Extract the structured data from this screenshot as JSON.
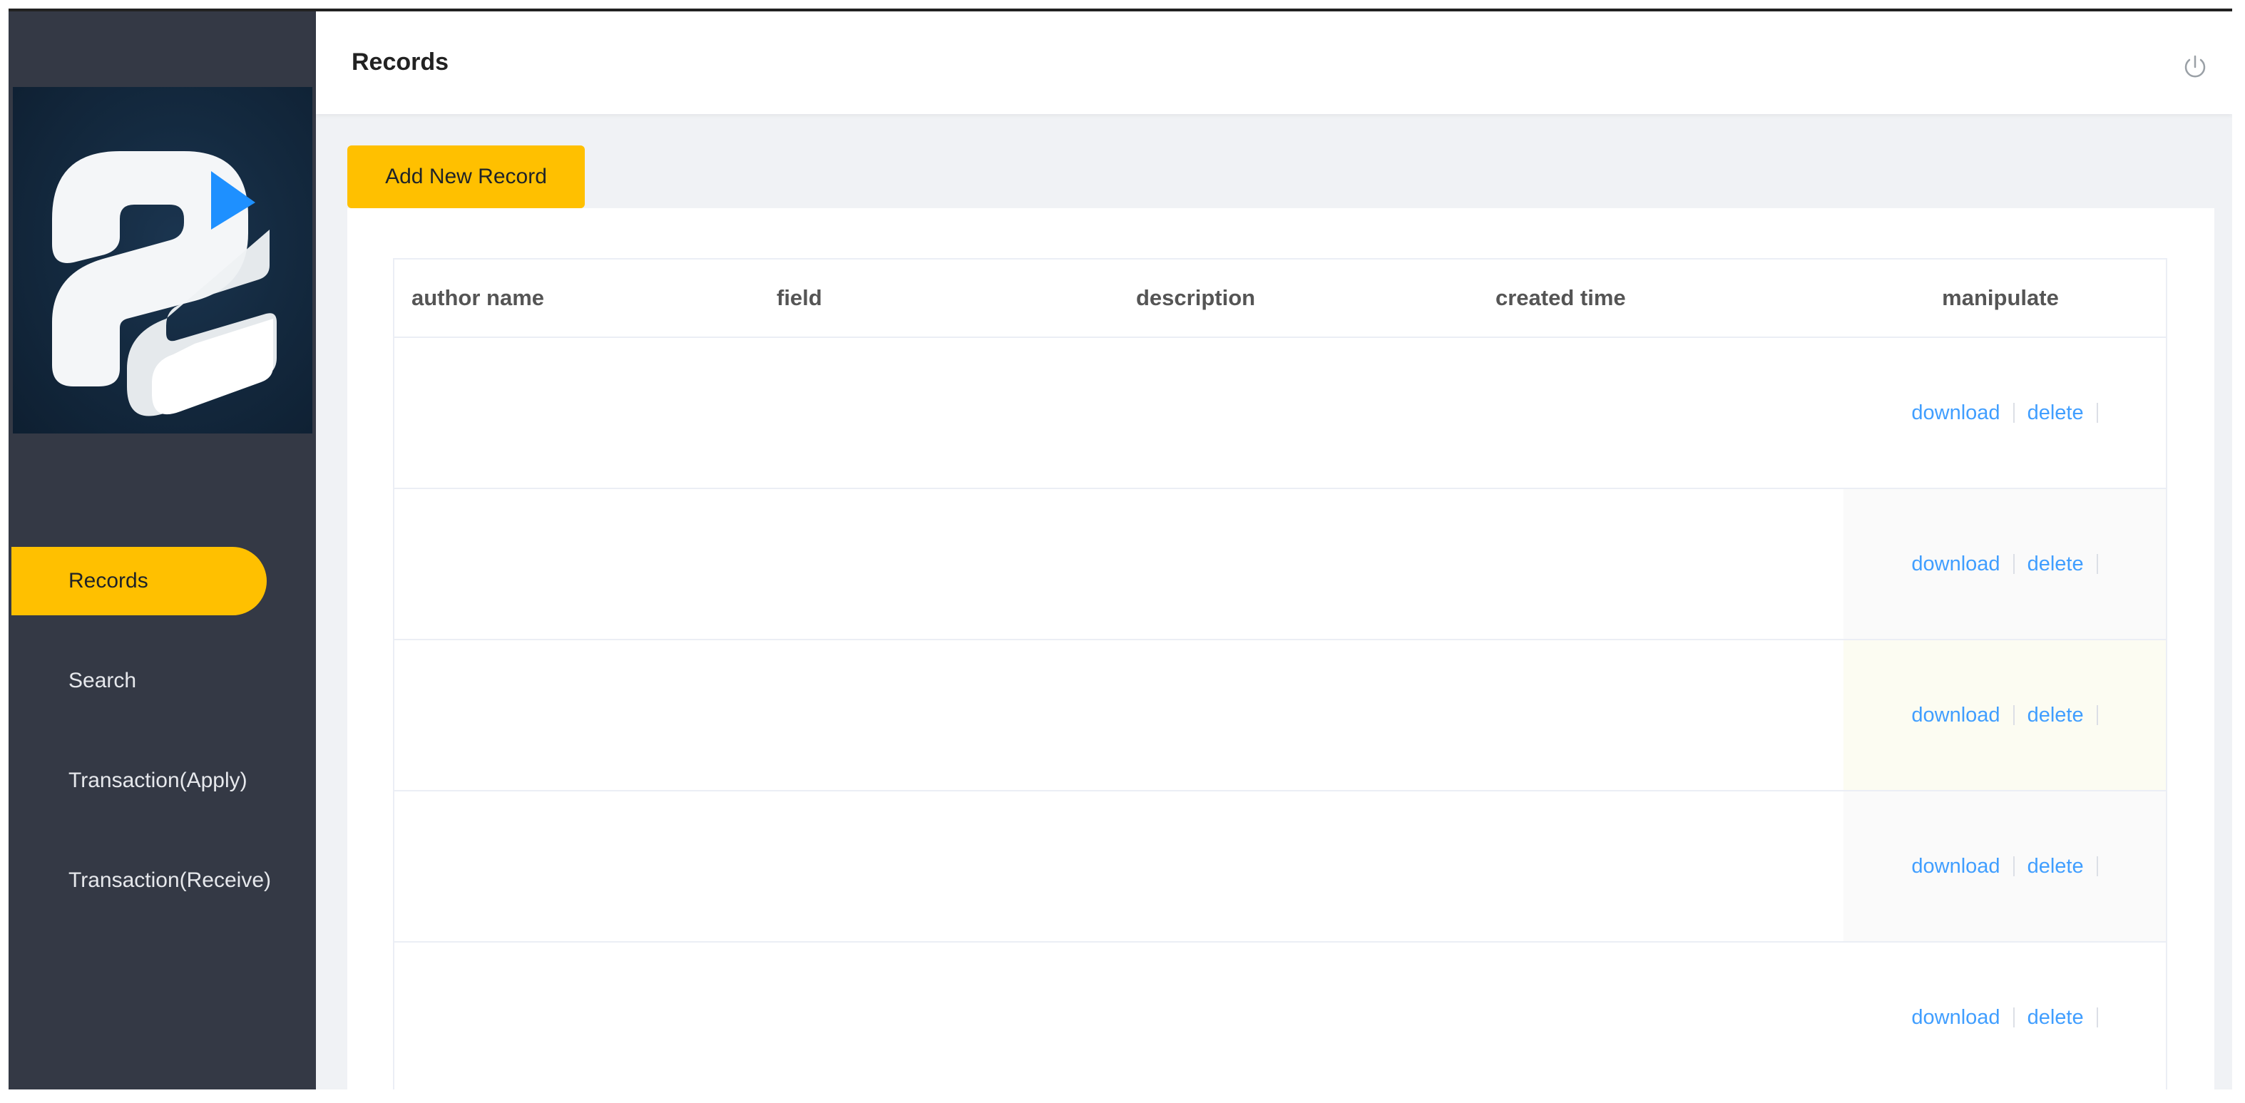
{
  "header": {
    "title": "Records",
    "power_icon": "power-icon"
  },
  "sidebar": {
    "logo_icon": "brand-logo",
    "items": [
      {
        "label": "Records",
        "active": true
      },
      {
        "label": "Search",
        "active": false
      },
      {
        "label": "Transaction(Apply)",
        "active": false
      },
      {
        "label": "Transaction(Receive)",
        "active": false
      }
    ]
  },
  "toolbar": {
    "add_label": "Add New Record"
  },
  "table": {
    "columns": [
      "author name",
      "field",
      "description",
      "created time",
      "manipulate"
    ],
    "rows": [
      {
        "download": "download",
        "delete": "delete"
      },
      {
        "download": "download",
        "delete": "delete"
      },
      {
        "download": "download",
        "delete": "delete"
      },
      {
        "download": "download",
        "delete": "delete"
      },
      {
        "download": "download",
        "delete": "delete"
      }
    ]
  },
  "colors": {
    "accent": "#ffc000",
    "sidebar_bg": "#343945",
    "link": "#409eff"
  }
}
